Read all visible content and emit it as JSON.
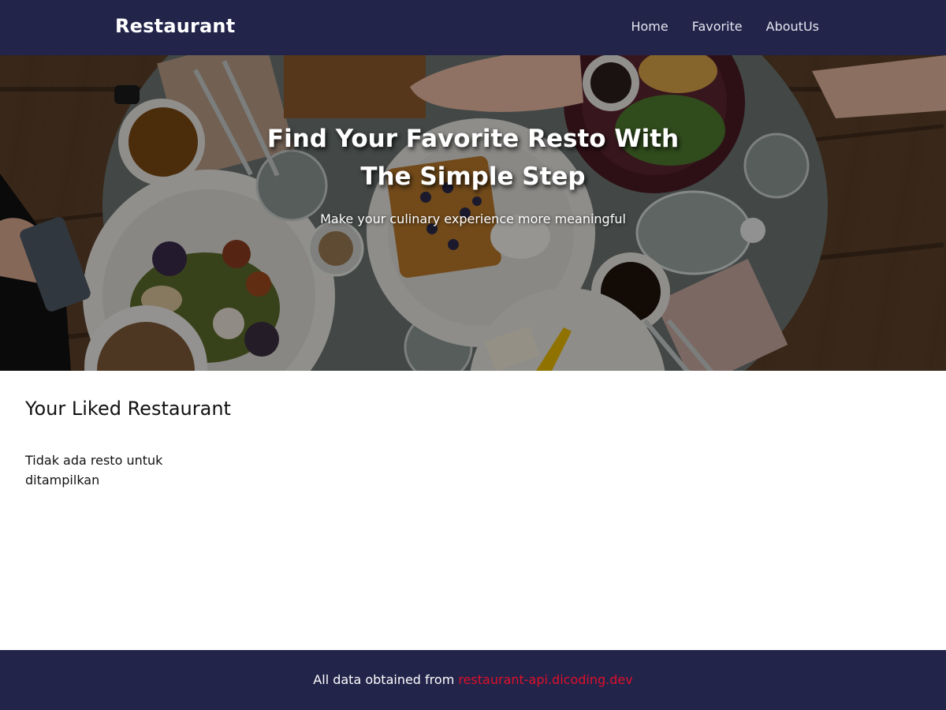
{
  "header": {
    "brand": "Restaurant",
    "nav": [
      "Home",
      "Favorite",
      "AboutUs"
    ]
  },
  "hero": {
    "title": "Find Your Favorite Resto With The Simple Step",
    "subtitle": "Make your culinary experience more meaningful"
  },
  "main": {
    "title": "Your Liked Restaurant",
    "empty_message": "Tidak ada resto untuk ditampilkan"
  },
  "footer": {
    "text": "All data obtained from",
    "link_text": "restaurant-api.dicoding.dev"
  },
  "colors": {
    "navbar": "#22244a",
    "footer": "#22244a",
    "link_accent": "#e0102a",
    "hero_overlay": "rgba(0,0,0,0.38)"
  }
}
